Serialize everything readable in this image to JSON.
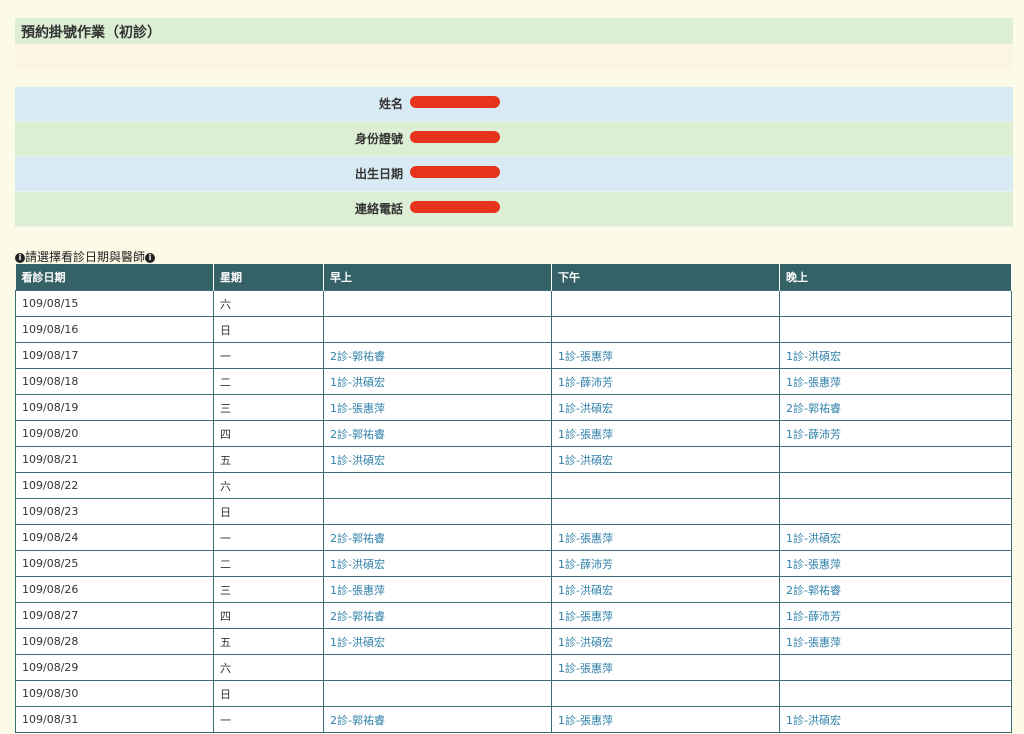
{
  "header": {
    "title": "預約掛號作業（初診）"
  },
  "patient_form": {
    "fields": [
      {
        "label": "姓名"
      },
      {
        "label": "身份證號"
      },
      {
        "label": "出生日期"
      },
      {
        "label": "連絡電話"
      }
    ]
  },
  "instruction": "請選擇看診日期與醫師",
  "schedule": {
    "columns": [
      "看診日期",
      "星期",
      "早上",
      "下午",
      "晚上"
    ],
    "rows": [
      {
        "date": "109/08/15",
        "weekday": "六",
        "morning": "",
        "afternoon": "",
        "evening": ""
      },
      {
        "date": "109/08/16",
        "weekday": "日",
        "morning": "",
        "afternoon": "",
        "evening": ""
      },
      {
        "date": "109/08/17",
        "weekday": "一",
        "morning": "2診-郭祐睿",
        "afternoon": "1診-張惠萍",
        "evening": "1診-洪碩宏"
      },
      {
        "date": "109/08/18",
        "weekday": "二",
        "morning": "1診-洪碩宏",
        "afternoon": "1診-薛沛芳",
        "evening": "1診-張惠萍"
      },
      {
        "date": "109/08/19",
        "weekday": "三",
        "morning": "1診-張惠萍",
        "afternoon": "1診-洪碩宏",
        "evening": "2診-郭祐睿"
      },
      {
        "date": "109/08/20",
        "weekday": "四",
        "morning": "2診-郭祐睿",
        "afternoon": "1診-張惠萍",
        "evening": "1診-薛沛芳"
      },
      {
        "date": "109/08/21",
        "weekday": "五",
        "morning": "1診-洪碩宏",
        "afternoon": "1診-洪碩宏",
        "evening": ""
      },
      {
        "date": "109/08/22",
        "weekday": "六",
        "morning": "",
        "afternoon": "",
        "evening": ""
      },
      {
        "date": "109/08/23",
        "weekday": "日",
        "morning": "",
        "afternoon": "",
        "evening": ""
      },
      {
        "date": "109/08/24",
        "weekday": "一",
        "morning": "2診-郭祐睿",
        "afternoon": "1診-張惠萍",
        "evening": "1診-洪碩宏"
      },
      {
        "date": "109/08/25",
        "weekday": "二",
        "morning": "1診-洪碩宏",
        "afternoon": "1診-薛沛芳",
        "evening": "1診-張惠萍"
      },
      {
        "date": "109/08/26",
        "weekday": "三",
        "morning": "1診-張惠萍",
        "afternoon": "1診-洪碩宏",
        "evening": "2診-郭祐睿"
      },
      {
        "date": "109/08/27",
        "weekday": "四",
        "morning": "2診-郭祐睿",
        "afternoon": "1診-張惠萍",
        "evening": "1診-薛沛芳"
      },
      {
        "date": "109/08/28",
        "weekday": "五",
        "morning": "1診-洪碩宏",
        "afternoon": "1診-洪碩宏",
        "evening": "1診-張惠萍"
      },
      {
        "date": "109/08/29",
        "weekday": "六",
        "morning": "",
        "afternoon": "1診-張惠萍",
        "evening": ""
      },
      {
        "date": "109/08/30",
        "weekday": "日",
        "morning": "",
        "afternoon": "",
        "evening": ""
      },
      {
        "date": "109/08/31",
        "weekday": "一",
        "morning": "2診-郭祐睿",
        "afternoon": "1診-張惠萍",
        "evening": "1診-洪碩宏"
      }
    ]
  },
  "colors": {
    "page_bg": "#fcfbe8",
    "title_bg": "#dcefd4",
    "row_blue": "#d8eaf3",
    "row_green": "#dcefd4",
    "table_header": "#346266",
    "slot_link": "#2d7fa8",
    "redaction": "#e8331c"
  }
}
